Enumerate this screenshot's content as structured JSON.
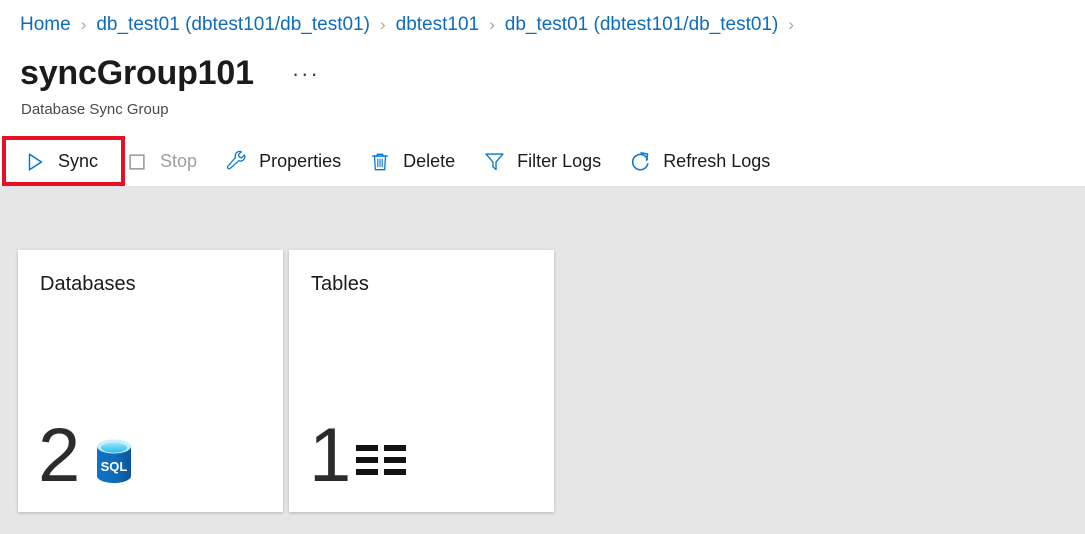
{
  "breadcrumb": {
    "separator": "›",
    "items": [
      {
        "label": "Home"
      },
      {
        "label": "db_test01 (dbtest101/db_test01)"
      },
      {
        "label": "dbtest101"
      },
      {
        "label": "db_test01 (dbtest101/db_test01)"
      }
    ],
    "trailing_separator": "›"
  },
  "header": {
    "title": "syncGroup101",
    "subtitle": "Database Sync Group",
    "more_menu": "···"
  },
  "toolbar": {
    "buttons": [
      {
        "label": "Sync",
        "icon": "play-icon",
        "disabled": false,
        "highlighted": true
      },
      {
        "label": "Stop",
        "icon": "stop-icon",
        "disabled": true,
        "highlighted": false
      },
      {
        "label": "Properties",
        "icon": "wrench-icon",
        "disabled": false,
        "highlighted": false
      },
      {
        "label": "Delete",
        "icon": "trash-icon",
        "disabled": false,
        "highlighted": false
      },
      {
        "label": "Filter Logs",
        "icon": "funnel-icon",
        "disabled": false,
        "highlighted": false
      },
      {
        "label": "Refresh Logs",
        "icon": "refresh-icon",
        "disabled": false,
        "highlighted": false
      }
    ]
  },
  "cards": [
    {
      "title": "Databases",
      "value": "2",
      "icon": "sql-database-icon"
    },
    {
      "title": "Tables",
      "value": "1",
      "icon": "table-grid-icon"
    }
  ],
  "colors": {
    "accent_blue": "#0f6cbd",
    "icon_blue": "#0078d4",
    "highlight_red": "#e81123",
    "content_background": "#e6e6e6",
    "sql_icon_blue": "#0d6cb9",
    "sql_icon_cyan": "#37c6f4",
    "disabled_grey": "#a19f9d"
  }
}
